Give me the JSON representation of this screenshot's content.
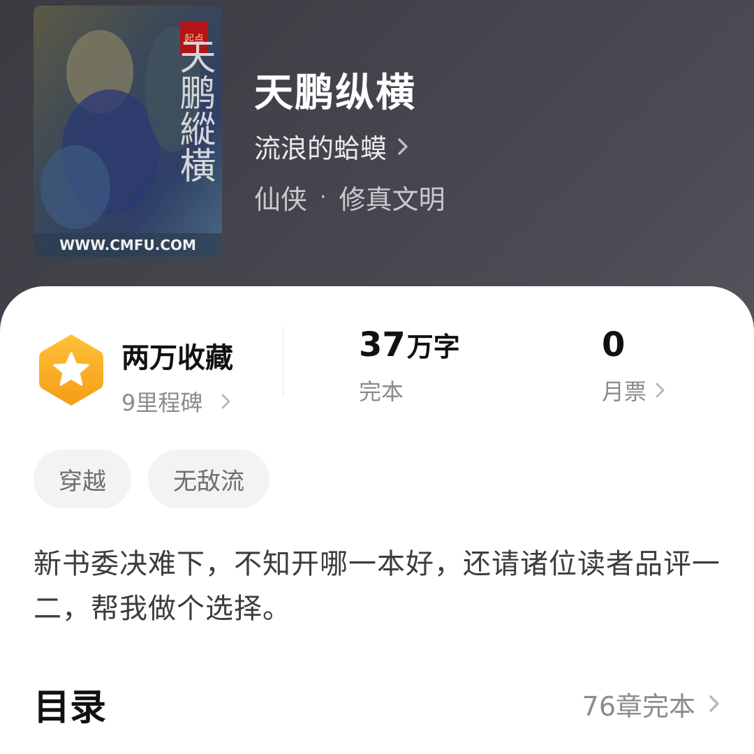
{
  "book": {
    "title": "天鹏纵横",
    "author": "流浪的蛤蟆",
    "category": "仙侠",
    "subcategory": "修真文明",
    "category_separator": "·",
    "cover": {
      "title_text": "天鹏縱橫",
      "site_text": "WWW.CMFU.COM"
    }
  },
  "stats": {
    "favorites_label": "两万收藏",
    "milestones_label": "9里程碑",
    "word_count": "37",
    "word_unit": "万字",
    "status": "完本",
    "monthly_tickets": "0",
    "monthly_tickets_label": "月票"
  },
  "tags": [
    "穿越",
    "无敌流"
  ],
  "description": "新书委决难下，不知开哪一本好，还请诸位读者品评一二，帮我做个选择。",
  "toc": {
    "title": "目录",
    "summary": "76章完本"
  },
  "colors": {
    "header_bg": "#44444c",
    "badge_orange": "#fbb02a",
    "card_bg": "#ffffff"
  }
}
